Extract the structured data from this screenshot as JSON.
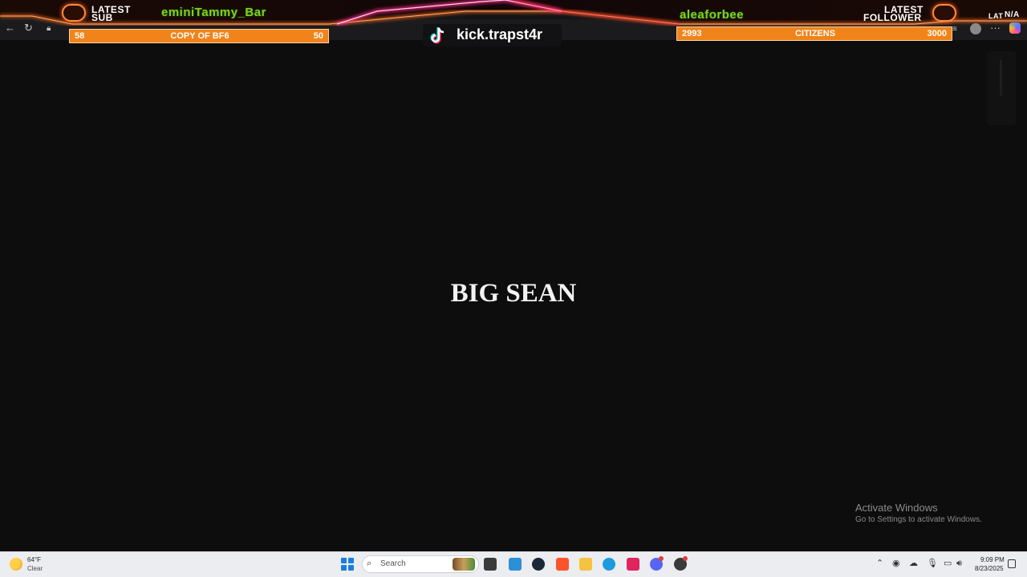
{
  "overlay": {
    "latest_sub": {
      "label_line1": "LATEST",
      "label_line2": "SUB",
      "name": "eminiTammy_Bar"
    },
    "latest_follower": {
      "label_line1": "LATEST",
      "label_line2": "FOLLOWER",
      "name": "aleaforbee"
    },
    "goal_left": {
      "current": "58",
      "title": "COPY OF BF6",
      "target": "50"
    },
    "goal_right": {
      "current": "2993",
      "title": "CITIZENS",
      "target": "3000"
    },
    "handle": "kick.trapst4r",
    "corner_label": "LAT",
    "corner_value": "N/A",
    "colors": {
      "accent_orange": "#f0841a",
      "neon_pink": "#ff2a8a",
      "name_green": "#7ed321"
    }
  },
  "browser": {
    "icons": [
      "back-icon",
      "reload-icon",
      "lock-icon",
      "profile-icon",
      "more-icon",
      "copilot-icon"
    ],
    "more_label": "···"
  },
  "main": {
    "title": "BIG SEAN"
  },
  "watermark": {
    "title": "Activate Windows",
    "subtitle": "Go to Settings to activate Windows."
  },
  "taskbar": {
    "weather_temp": "64°F",
    "weather_condition": "Clear",
    "search_placeholder": "Search",
    "clock_time": "9:09 PM",
    "clock_date": "8/23/2025",
    "pinned_apps": [
      "file-explorer-icon",
      "notepad-icon",
      "steam-icon",
      "brave-icon",
      "folder-icon",
      "edge-icon",
      "tiktok-icon",
      "discord-icon",
      "obs-icon"
    ]
  }
}
